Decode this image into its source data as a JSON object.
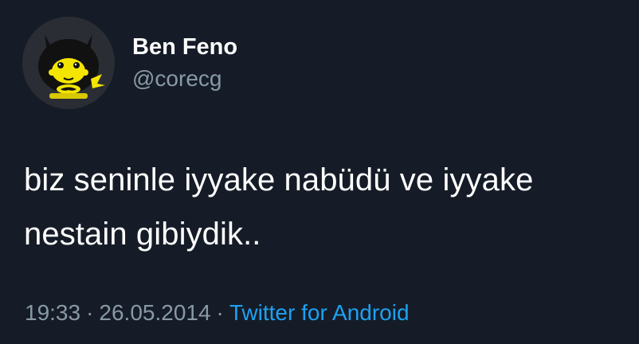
{
  "tweet": {
    "display_name": "Ben Feno",
    "handle": "@corecg",
    "text_line_1": "biz seninle iyyake nabüdü ve iyyake",
    "text_line_2": "nestain gibiydik..",
    "time": "19:33",
    "separator": "·",
    "date": "26.05.2014",
    "source": "Twitter for Android"
  },
  "avatar": {
    "icon": "pikachu-batman-avatar-icon"
  },
  "colors": {
    "background": "#151c27",
    "name": "#ffffff",
    "secondary_text": "#8899a6",
    "link": "#1da1f2"
  }
}
